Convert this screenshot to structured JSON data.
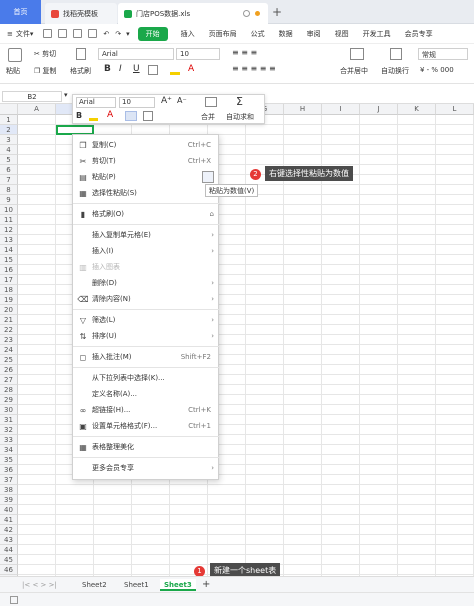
{
  "tabs": {
    "home": "首页",
    "templates": "找稻壳模板",
    "file": "门店POS数据.xls",
    "new_tab": "+"
  },
  "menu": {
    "file_label": "文件",
    "file_caret": "▾",
    "start": "开始",
    "items": [
      "插入",
      "页面布局",
      "公式",
      "数据",
      "审阅",
      "视图",
      "开发工具",
      "会员专享"
    ]
  },
  "ribbon": {
    "paste": "粘贴",
    "cut": "剪切",
    "copy": "复制",
    "format_painter": "格式刷",
    "font": "Arial",
    "font_size": "10",
    "bold": "B",
    "italic": "I",
    "underline": "U",
    "merge_center": "合并居中",
    "wrap": "自动换行",
    "number_format": "常规",
    "percent": "¥ - % 000"
  },
  "formula_bar": {
    "cell_ref": "B2",
    "dropdown": "▾"
  },
  "mini_toolbar": {
    "font": "Arial",
    "size": "10",
    "bold": "B",
    "merge": "合并",
    "autosum": "自动求和"
  },
  "columns": [
    "A",
    "B",
    "C",
    "D",
    "E",
    "F",
    "G",
    "H",
    "I",
    "J",
    "K",
    "L"
  ],
  "rows": [
    "1",
    "2",
    "3",
    "4",
    "5",
    "6",
    "7",
    "8",
    "9",
    "10",
    "11",
    "12",
    "13",
    "14",
    "15",
    "16",
    "17",
    "18",
    "19",
    "20",
    "21",
    "22",
    "23",
    "24",
    "25",
    "26",
    "27",
    "28",
    "29",
    "30",
    "31",
    "32",
    "33",
    "34",
    "35",
    "36",
    "37",
    "38",
    "39",
    "40",
    "41",
    "42",
    "43",
    "44",
    "45",
    "46",
    "47"
  ],
  "context_menu": {
    "copy": "复制(C)",
    "copy_sc": "Ctrl+C",
    "cut": "剪切(T)",
    "cut_sc": "Ctrl+X",
    "paste": "粘贴(P)",
    "paste_special": "选择性粘贴(S)",
    "format_painter": "格式刷(O)",
    "insert_copied": "插入复制单元格(E)",
    "insert": "插入(I)",
    "insert_chart": "插入图表",
    "delete": "删除(D)",
    "clear": "清除内容(N)",
    "filter": "筛选(L)",
    "sort": "排序(U)",
    "insert_comment": "插入批注(M)",
    "comment_sc": "Shift+F2",
    "pick_list": "从下拉列表中选择(K)...",
    "define_name": "定义名称(A)...",
    "hyperlink": "超链接(H)...",
    "hyperlink_sc": "Ctrl+K",
    "format_cells": "设置单元格格式(F)...",
    "format_sc": "Ctrl+1",
    "beautify": "表格整理美化",
    "more": "更多会员专享"
  },
  "tooltip": "粘贴为数值(V)",
  "callouts": {
    "step2_num": "2",
    "step2_text": "右键选择性粘贴为数值",
    "step1_num": "1",
    "step1_text": "新建一个sheet表"
  },
  "sheets": {
    "nav": "|<  <  >  >|",
    "s1": "Sheet2",
    "s2": "Sheet1",
    "s3": "Sheet3",
    "add": "+"
  },
  "colors": {
    "accent_blue": "#4a7bea",
    "start_green": "#1aa84a",
    "active_sheet": "#1aa84a",
    "badge_red": "#e53935",
    "callout_bg": "#4c4c4c"
  }
}
